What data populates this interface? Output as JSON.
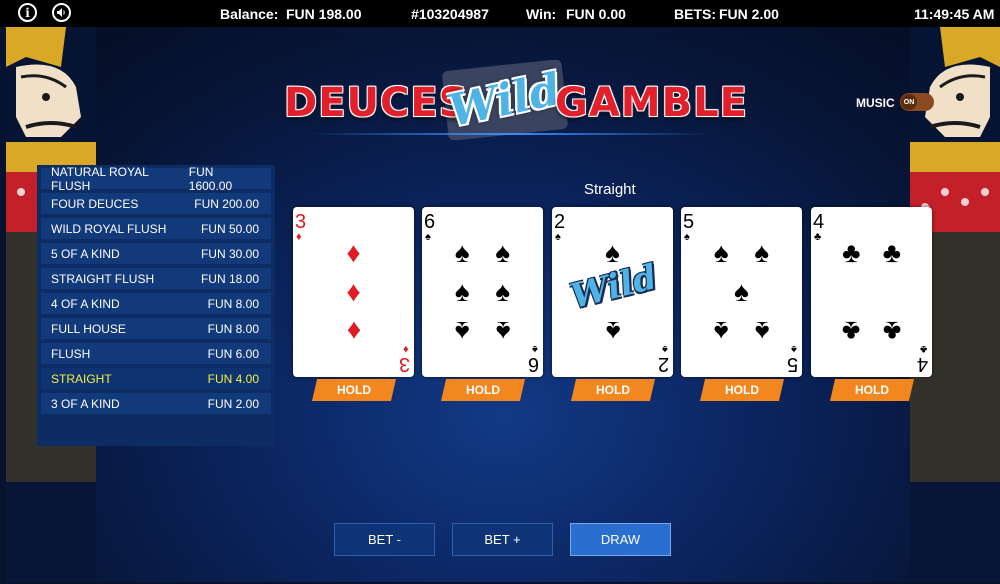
{
  "topbar": {
    "balance_label": "Balance:",
    "balance_value": "FUN 198.00",
    "game_id": "#103204987",
    "win_label": "Win:",
    "win_value": "FUN 0.00",
    "bets_label": "BETS:",
    "bets_value": "FUN 2.00",
    "clock": "11:49:45 AM",
    "info_icon": "info-icon",
    "sound_icon": "speaker-icon"
  },
  "logo": {
    "part1": "DEUCES",
    "part2": "Wild",
    "part3": "GAMBLE"
  },
  "music": {
    "label": "MUSIC",
    "state": "ON"
  },
  "paytable": [
    {
      "hand": "NATURAL ROYAL FLUSH",
      "pay": "FUN 1600.00",
      "highlight": false
    },
    {
      "hand": "FOUR DEUCES",
      "pay": "FUN 200.00",
      "highlight": false
    },
    {
      "hand": "WILD ROYAL FLUSH",
      "pay": "FUN 50.00",
      "highlight": false
    },
    {
      "hand": "5 OF A KIND",
      "pay": "FUN 30.00",
      "highlight": false
    },
    {
      "hand": "STRAIGHT FLUSH",
      "pay": "FUN 18.00",
      "highlight": false
    },
    {
      "hand": "4 OF A KIND",
      "pay": "FUN 8.00",
      "highlight": false
    },
    {
      "hand": "FULL HOUSE",
      "pay": "FUN 8.00",
      "highlight": false
    },
    {
      "hand": "FLUSH",
      "pay": "FUN 6.00",
      "highlight": false
    },
    {
      "hand": "STRAIGHT",
      "pay": "FUN 4.00",
      "highlight": true
    },
    {
      "hand": "3 OF A KIND",
      "pay": "FUN 2.00",
      "highlight": false
    }
  ],
  "result": "Straight",
  "cards": [
    {
      "rank": "3",
      "suit": "♦",
      "color": "#e01b24"
    },
    {
      "rank": "6",
      "suit": "♠",
      "color": "#000000"
    },
    {
      "rank": "2",
      "suit": "♠",
      "color": "#000000",
      "wild_label": "Wild"
    },
    {
      "rank": "5",
      "suit": "♠",
      "color": "#000000"
    },
    {
      "rank": "4",
      "suit": "♣",
      "color": "#000000"
    }
  ],
  "hold_label": "HOLD",
  "buttons": {
    "bet_minus": "BET -",
    "bet_plus": "BET +",
    "draw": "DRAW"
  },
  "colors": {
    "hold": "#f2861f",
    "highlight_row": "#f2f243",
    "logo_red": "#e2202b",
    "wild_blue": "#4fb3e6"
  }
}
